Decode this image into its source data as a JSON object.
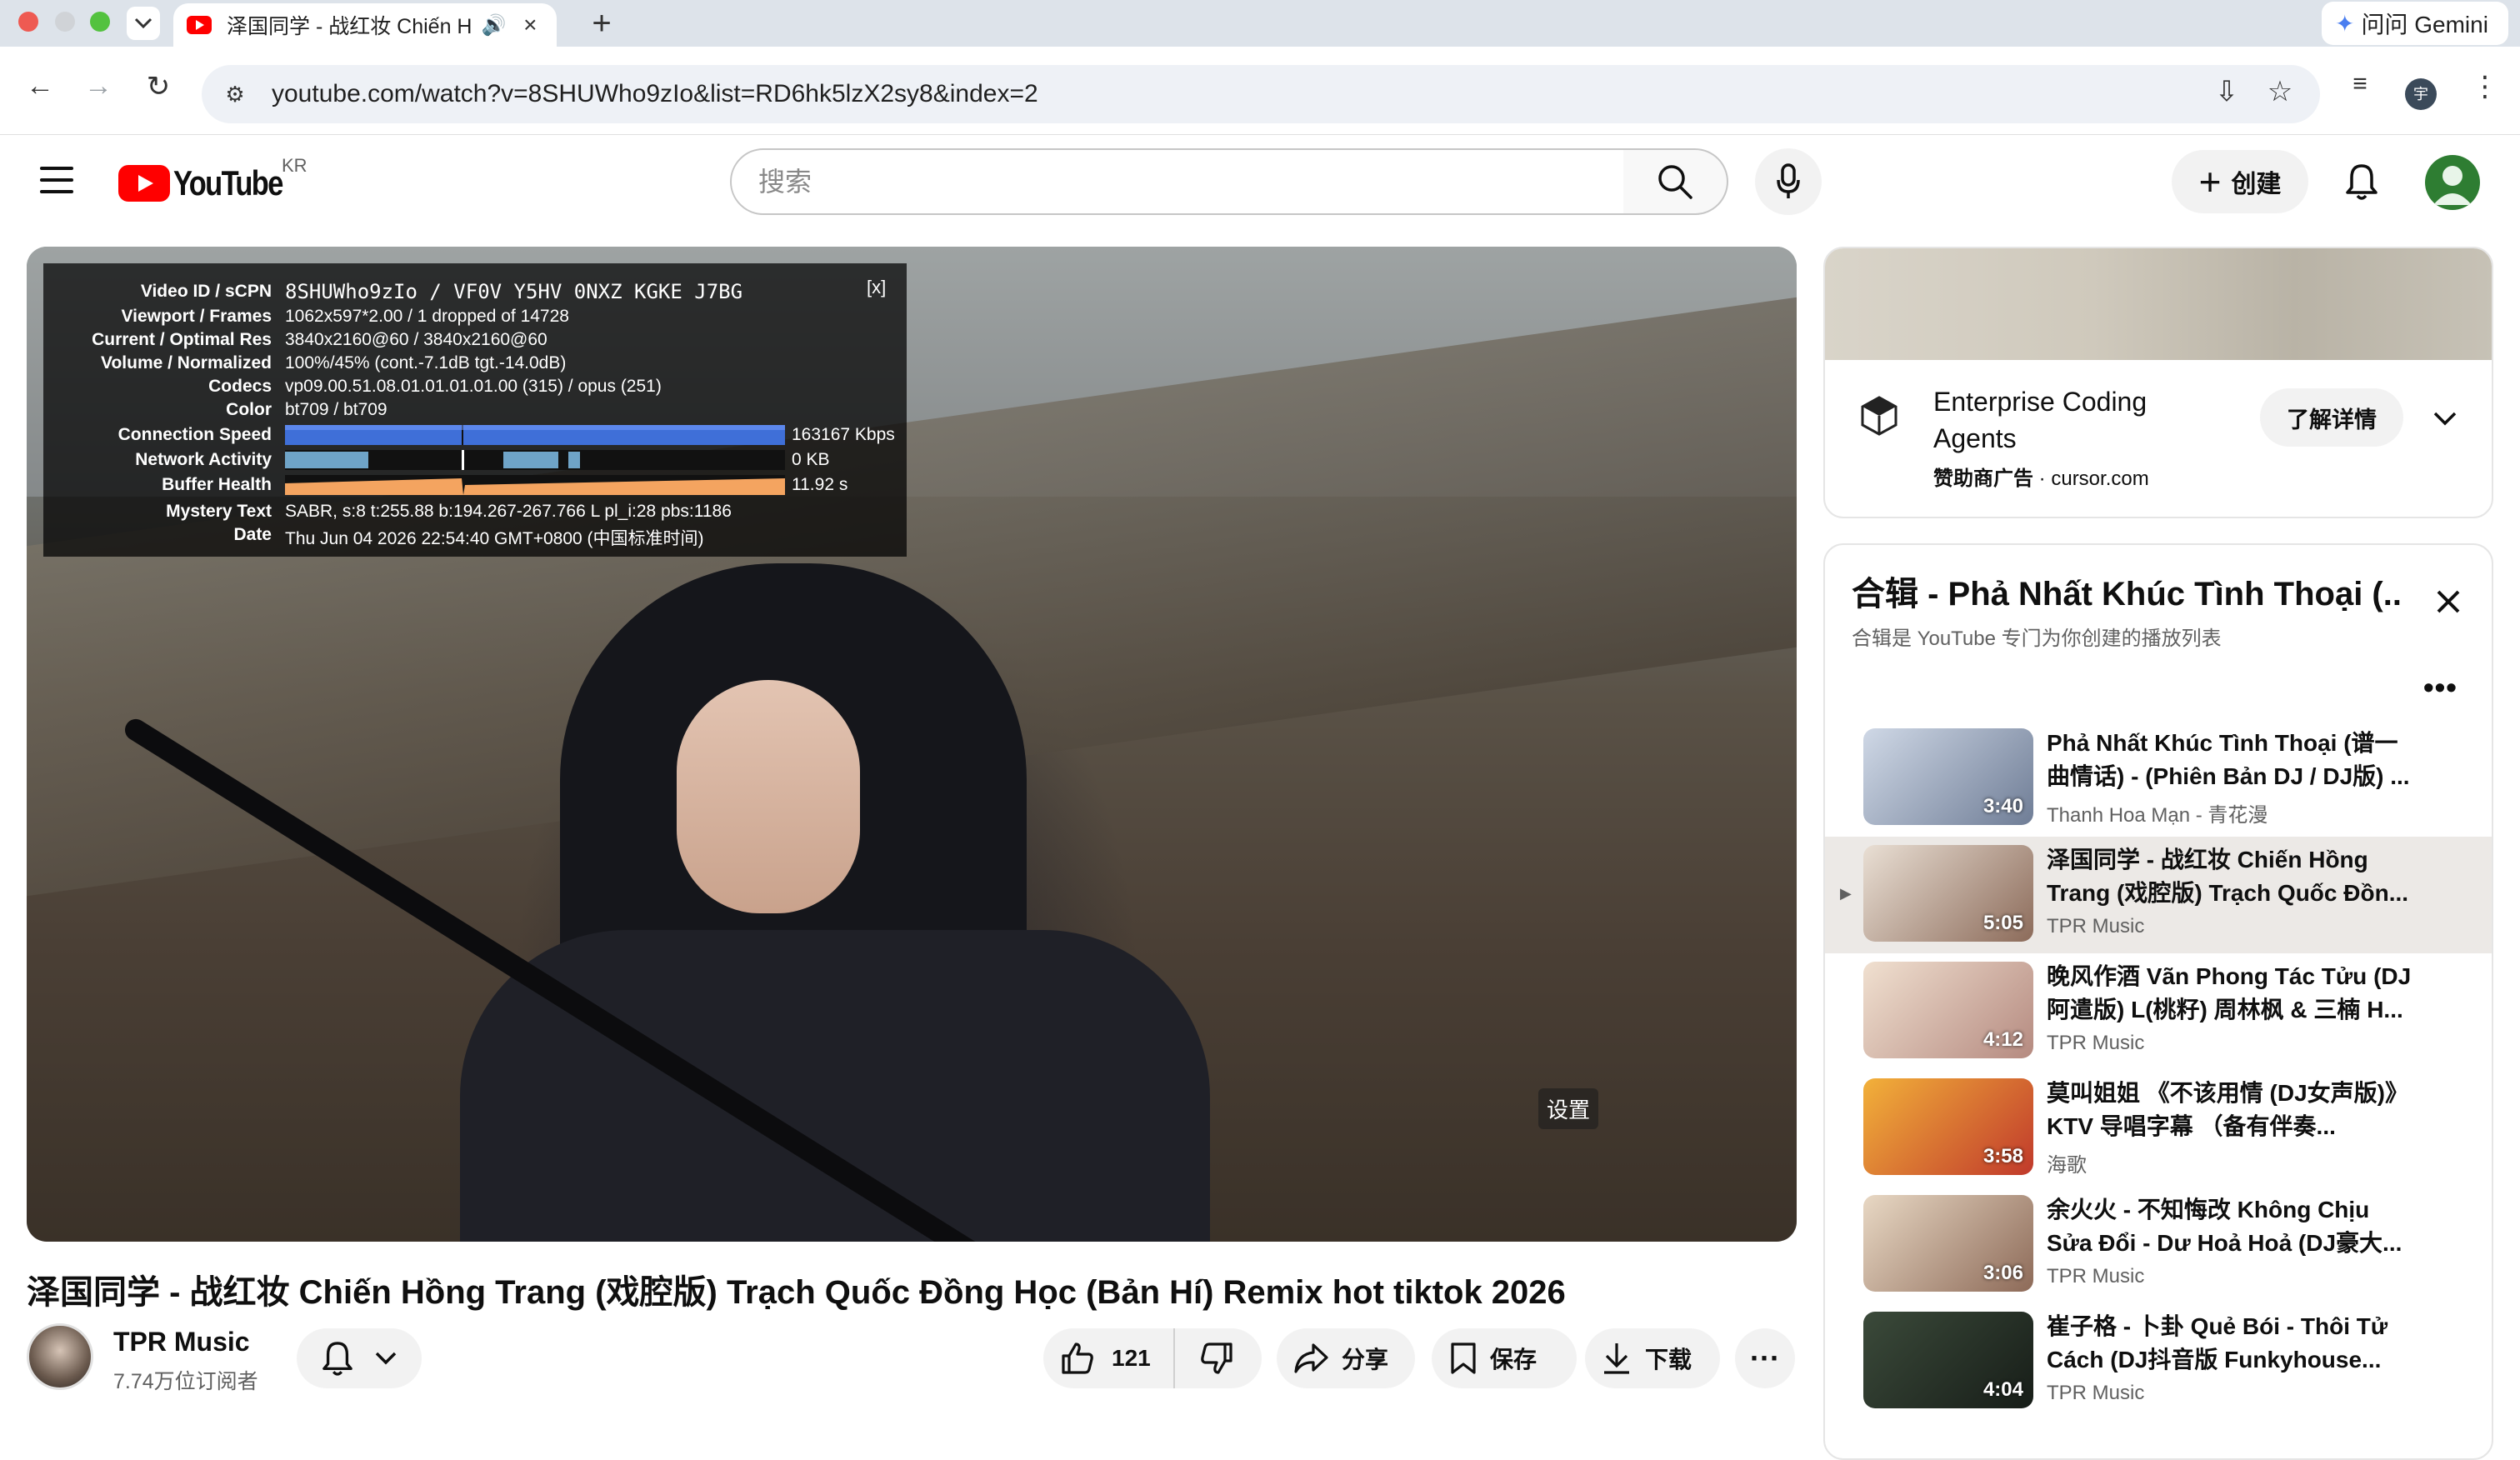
{
  "browser": {
    "tab_title": "泽国同学 - 战红妆 Chiến H",
    "tab_audio_icon": "🔊",
    "url": "youtube.com/watch?v=8SHUWho9zIo&list=RD6hk5lzX2sy8&index=2",
    "gemini_label": "问问 Gemini",
    "profile_initial": "宇"
  },
  "masthead": {
    "logo_text": "YouTube",
    "region": "KR",
    "search_placeholder": "搜索",
    "create_label": "创建"
  },
  "player": {
    "settings_label": "设置",
    "stats": {
      "close_label": "[x]",
      "rows": [
        {
          "label": "Video ID / sCPN",
          "value": "8SHUWho9zIo / VF0V Y5HV 0NXZ KGKE J7BG"
        },
        {
          "label": "Viewport / Frames",
          "value": "1062x597*2.00 / 1 dropped of 14728"
        },
        {
          "label": "Current / Optimal Res",
          "value": "3840x2160@60 / 3840x2160@60"
        },
        {
          "label": "Volume / Normalized",
          "value": "100%/45% (cont.-7.1dB tgt.-14.0dB)"
        },
        {
          "label": "Codecs",
          "value": "vp09.00.51.08.01.01.01.01.00 (315) / opus (251)"
        },
        {
          "label": "Color",
          "value": "bt709 / bt709"
        },
        {
          "label": "Connection Speed",
          "value": "163167 Kbps"
        },
        {
          "label": "Network Activity",
          "value": "0 KB"
        },
        {
          "label": "Buffer Health",
          "value": "11.92 s"
        },
        {
          "label": "Mystery Text",
          "value": "SABR, s:8 t:255.88 b:194.267-267.766 L pl_i:28 pbs:1186"
        },
        {
          "label": "Date",
          "value": "Thu Jun 04 2026 22:54:40 GMT+0800 (中国标准时间)"
        }
      ]
    }
  },
  "video": {
    "title": "泽国同学 - 战红妆 Chiến Hồng Trang (戏腔版) Trạch Quốc Đồng Học (Bản Hí) Remix hot tiktok 2026",
    "channel": "TPR Music",
    "subscribers": "7.74万位订阅者",
    "likes": "121",
    "share_label": "分享",
    "save_label": "保存",
    "download_label": "下载",
    "more_label": "···"
  },
  "ad": {
    "title": "Enterprise Coding Agents",
    "sponsor_label": "赞助商广告",
    "domain": "cursor.com",
    "learn_more": "了解详情"
  },
  "playlist": {
    "title": "合辑 - Phả Nhất Khúc Tình Thoại (...",
    "subtitle": "合辑是 YouTube 专门为你创建的播放列表",
    "more_label": "•••",
    "current_marker": "▶",
    "items": [
      {
        "title": "Phả Nhất Khúc Tình Thoại (谱一曲情话) - (Phiên Bản DJ / DJ版) ...",
        "channel": "Thanh Hoa Mạn - 青花漫",
        "duration": "3:40",
        "colors": [
          "#cfd8e6",
          "#6f7d96"
        ]
      },
      {
        "title": "泽国同学 - 战红妆 Chiến Hồng Trang (戏腔版) Trạch Quốc Đồn...",
        "channel": "TPR Music",
        "duration": "5:05",
        "colors": [
          "#e9dfd4",
          "#8c6b5a"
        ]
      },
      {
        "title": "晚风作酒 Vãn Phong Tác Tửu (DJ阿遣版) L(桃籽) 周林枫 & 三楠 H...",
        "channel": "TPR Music",
        "duration": "4:12",
        "colors": [
          "#f0e0d0",
          "#b58a80"
        ]
      },
      {
        "title": "莫叫姐姐 《不该用情 (DJ女声版)》 KTV 导唱字幕 （备有伴奏...",
        "channel": "海歌",
        "duration": "3:58",
        "colors": [
          "#f2b13a",
          "#c0392b"
        ]
      },
      {
        "title": "余火火 - 不知悔改 Không Chịu Sửa Đổi - Dư Hoả Hoả (DJ豪大...",
        "channel": "TPR Music",
        "duration": "3:06",
        "colors": [
          "#e8d8c4",
          "#8d6a58"
        ]
      },
      {
        "title": "崔子格 - 卜卦 Quẻ Bói - Thôi Tử Cách (DJ抖音版 Funkyhouse...",
        "channel": "TPR Music",
        "duration": "4:04",
        "colors": [
          "#3b4a3a",
          "#171d18"
        ]
      }
    ]
  }
}
